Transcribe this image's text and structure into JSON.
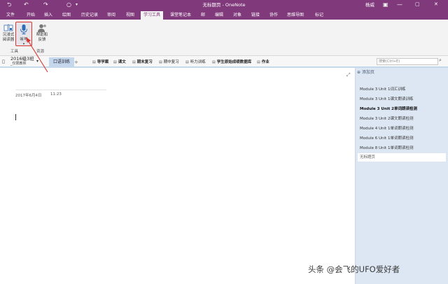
{
  "titlebar": {
    "title": "无标题页 - OneNote",
    "user": "杨威",
    "back_icon": "back-arrow-icon",
    "undo_icon": "undo-icon",
    "redo_icon": "redo-icon",
    "minimize": "—",
    "restore": "▢",
    "close": "✕"
  },
  "menu": {
    "tabs": [
      "文件",
      "开始",
      "插入",
      "绘图",
      "历史记录",
      "审阅",
      "视图",
      "学习工具",
      "课堂笔记本",
      "邮",
      "编辑",
      "对象",
      "链接",
      "协作",
      "思维导图",
      "标记"
    ],
    "active": "学习工具"
  },
  "ribbon": {
    "immersive_reader": [
      "沉浸式",
      "阅读器"
    ],
    "dictate": "听写",
    "help_feedback": [
      "帮助和",
      "反馈"
    ],
    "group_tools": "工具",
    "group_resources": "资源"
  },
  "notebook": {
    "name": "2016级3班",
    "sub": "_仅限教师"
  },
  "sections": {
    "active": "口语训练",
    "add": "+",
    "groups": [
      "导学案",
      "课文",
      "期末复习",
      "期中复习",
      "听力训练",
      "学生原始成绩数据库",
      "作业"
    ]
  },
  "search": {
    "placeholder": "搜索(Ctrl+E)"
  },
  "page": {
    "date": "2017年6月4日",
    "time": "11:23"
  },
  "pages": {
    "add_page": "添加页",
    "items": [
      "Module 3 Unit 1词汇训练",
      "Module 3 Unit 1课文朗读训练",
      "Module 3 Unit 2单词朗读检测",
      "Module 3 Unit 2课文朗读检测",
      "Module 4 Unit 1单词朗读检测",
      "Module 6 Unit 1单词朗读检测",
      "Module 8 Unit 1单词朗读检测"
    ],
    "bold_index": 2,
    "untitled": "无标题页"
  },
  "watermark": "头条 @会飞的UFO爱好者",
  "colors": {
    "accent": "#80397b",
    "panel": "#dde7f3",
    "highlight": "#d9332b"
  }
}
